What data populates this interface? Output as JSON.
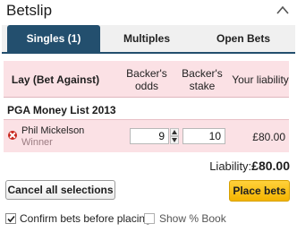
{
  "header": {
    "title": "Betslip"
  },
  "tabs": [
    {
      "label": "Singles (1)",
      "active": true
    },
    {
      "label": "Multiples",
      "active": false
    },
    {
      "label": "Open Bets",
      "active": false
    }
  ],
  "columns": {
    "bet_type": "Lay (Bet Against)",
    "odds_line1": "Backer's",
    "odds_line2": "odds",
    "stake_line1": "Backer's",
    "stake_line2": "stake",
    "liability": "Your liability"
  },
  "market": "PGA Money List 2013",
  "bet": {
    "runner": "Phil Mickelson",
    "type": "Winner",
    "odds": "9",
    "stake": "10",
    "liability": "£80.00"
  },
  "summary": {
    "label": "Liability:",
    "value": "£80.00"
  },
  "actions": {
    "cancel_label": "Cancel all selections",
    "place_label": "Place bets"
  },
  "options": {
    "confirm_label": "Confirm bets before placing",
    "confirm_checked": true,
    "showbook_label": "Show % Book",
    "showbook_checked": false
  },
  "colors": {
    "tab_active": "#234f6e",
    "lay_pink": "#fbe1e5",
    "place_button": "#f4b400",
    "link_blue": "#1a6fc1",
    "remove_red": "#c8261d"
  }
}
